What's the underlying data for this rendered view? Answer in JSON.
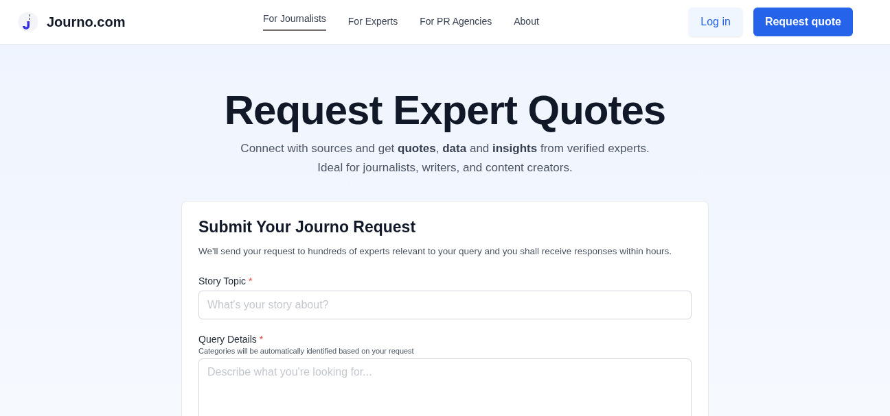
{
  "header": {
    "brand": "Journo.com",
    "nav": [
      {
        "label": "For Journalists",
        "selected": true
      },
      {
        "label": "For Experts",
        "selected": false
      },
      {
        "label": "For PR Agencies",
        "selected": false
      },
      {
        "label": "About",
        "selected": false
      }
    ],
    "buttons": [
      {
        "label": "Log in",
        "kind": "secondary"
      },
      {
        "label": "Request quote",
        "kind": "primary"
      }
    ]
  },
  "hero": {
    "title": "Request Expert Quotes",
    "subtitle": [
      "Connect with sources and get **quotes**, **data** and **insights** from verified experts.",
      "Ideal for journalists, writers, and content creators."
    ]
  },
  "form": {
    "title": "Submit Your Journo Request",
    "description": "We'll send your request to hundreds of experts relevant to your query and you shall receive responses within hours.",
    "fields": [
      {
        "label": "Story Topic",
        "required_mark": "*",
        "kind": "input",
        "placeholder": "What's your story about?"
      },
      {
        "label": "Query Details",
        "required_mark": "*",
        "hint": "Categories will be automatically identified based on your request",
        "kind": "textarea",
        "placeholder": "Describe what you're looking for..."
      }
    ]
  }
}
